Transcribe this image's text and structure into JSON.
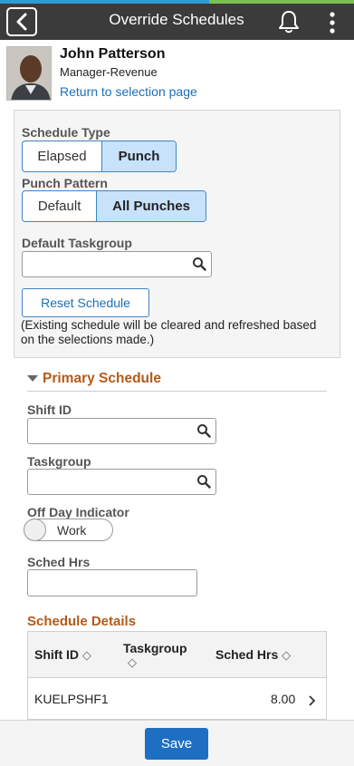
{
  "header": {
    "title": "Override Schedules",
    "back_icon": "chevron-left-icon",
    "notification_icon": "bell-icon",
    "menu_icon": "kebab-menu-icon",
    "colors": {
      "bar": "#3b3b3b",
      "accent_blue": "#2d9bd6",
      "accent_green": "#78c14f"
    }
  },
  "profile": {
    "name": "John Patterson",
    "role": "Manager-Revenue",
    "return_link": "Return to selection page"
  },
  "schedule_type": {
    "label": "Schedule Type",
    "options": [
      "Elapsed",
      "Punch"
    ],
    "selected": "Punch"
  },
  "punch_pattern": {
    "label": "Punch Pattern",
    "options": [
      "Default",
      "All Punches"
    ],
    "selected": "All Punches"
  },
  "default_taskgroup": {
    "label": "Default Taskgroup",
    "value": ""
  },
  "reset": {
    "button_label": "Reset Schedule",
    "note": "(Existing schedule will be cleared and refreshed based on the selections made.)"
  },
  "primary_schedule": {
    "title": "Primary Schedule",
    "shift_id": {
      "label": "Shift ID",
      "value": ""
    },
    "taskgroup": {
      "label": "Taskgroup",
      "value": ""
    },
    "off_day": {
      "label": "Off Day Indicator",
      "toggle_text": "Work",
      "on": false
    },
    "sched_hrs": {
      "label": "Sched Hrs",
      "value": ""
    }
  },
  "schedule_details": {
    "title": "Schedule Details",
    "columns": [
      "Shift ID",
      "Taskgroup",
      "Sched Hrs"
    ],
    "sort_glyph": "◇",
    "rows": [
      {
        "shift_id": "KUELPSHF1",
        "taskgroup": "",
        "sched_hrs": "8.00"
      }
    ]
  },
  "footer": {
    "save_label": "Save"
  },
  "colors": {
    "section_title": "#b35a1a",
    "link": "#1a6fba",
    "primary_button": "#1e6fc1",
    "selected_segment": "#c8e2fb"
  }
}
